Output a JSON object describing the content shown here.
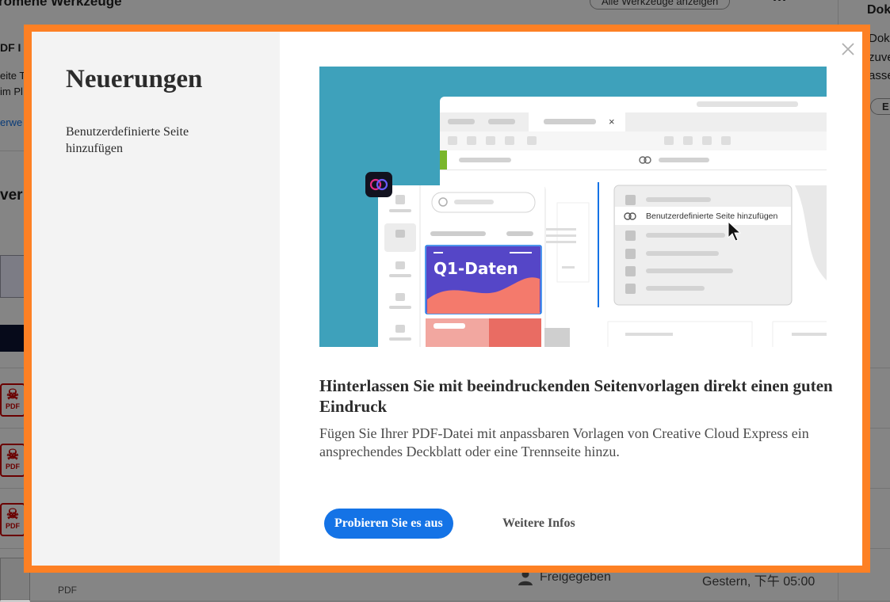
{
  "background": {
    "section_title": "romene Werkzeuge",
    "all_tools_button": "Alle Werkzeuge anzeigen",
    "more_menu": "···",
    "right_panel_title": "Dok",
    "right_panel_lines": [
      "Dok",
      "zuve",
      "asse"
    ],
    "right_panel_button": "E",
    "left_lines": [
      "DF I",
      "eite T",
      "im Pl"
    ],
    "left_link": "erwe",
    "recent_heading": "ver",
    "pdf_icon_label": "PDF",
    "row_type": "PDF",
    "shared_label": "Freigegeben",
    "time_label": "Gestern, 下午 05:00"
  },
  "modal": {
    "title": "Neuerungen",
    "nav_item": "Benutzerdefinierte Seite hinzufügen",
    "close_icon": "close-icon",
    "hero": {
      "card_title": "Q1-Daten",
      "menu_item": "Benutzerdefinierte Seite hinzufügen",
      "tab_close": "×"
    },
    "headline": "Hinterlassen Sie mit beeindruckenden Seitenvorlagen direkt einen guten Eindruck",
    "body": "Fügen Sie Ihrer PDF-Datei mit anpassbaren Vorlagen von Creative Cloud Express ein ansprechendes Deckblatt oder eine Trennseite hinzu.",
    "primary_button": "Probieren Sie es aus",
    "secondary_button": "Weitere Infos"
  },
  "colors": {
    "frame": "#fd8024",
    "hero_background": "#3ea1bb",
    "primary": "#1473e6",
    "card": "#5546c7",
    "wave": "#f47a6c"
  }
}
